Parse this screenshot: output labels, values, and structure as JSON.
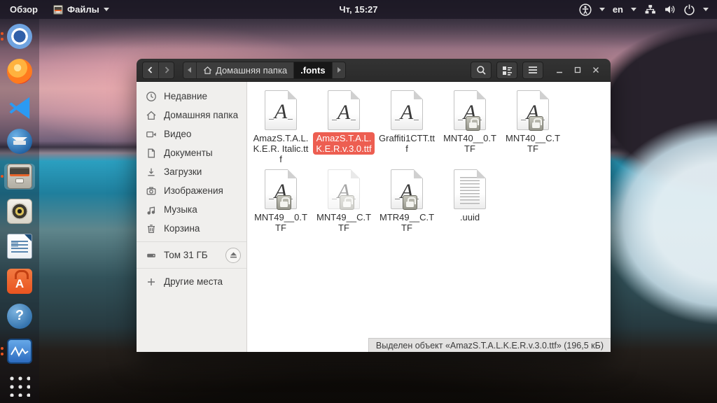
{
  "colors": {
    "selection": "#ed5e51",
    "ubuntu_orange": "#E95420",
    "headerbar_bg": "#2e2e2e",
    "sidebar_bg": "#f0efed"
  },
  "topbar": {
    "activities_label": "Обзор",
    "app_menu_label": "Файлы",
    "clock": "Чт, 15:27",
    "language_indicator": "en",
    "right_icons": [
      "accessibility-icon",
      "language-menu",
      "network-icon",
      "volume-icon",
      "power-icon"
    ]
  },
  "dock": {
    "items": [
      {
        "icon": "chromium-icon",
        "running_dots": 2,
        "active": false
      },
      {
        "icon": "firefox-icon",
        "running_dots": 0,
        "active": false
      },
      {
        "icon": "vscode-icon",
        "running_dots": 0,
        "active": false
      },
      {
        "icon": "thunderbird-icon",
        "running_dots": 0,
        "active": false
      },
      {
        "icon": "files-icon",
        "running_dots": 1,
        "active": true
      },
      {
        "icon": "rhythmbox-icon",
        "running_dots": 0,
        "active": false
      },
      {
        "icon": "libreoffice-writer-icon",
        "running_dots": 0,
        "active": false
      },
      {
        "icon": "ubuntu-software-icon",
        "running_dots": 0,
        "active": false
      },
      {
        "icon": "help-icon",
        "running_dots": 0,
        "active": false
      },
      {
        "icon": "system-monitor-icon",
        "running_dots": 2,
        "active": false
      },
      {
        "icon": "show-applications-icon",
        "running_dots": 0,
        "active": false
      }
    ],
    "help_glyph": "?",
    "software_glyph": "A"
  },
  "window": {
    "pathbar": {
      "home_label": "Домашняя папка",
      "current_segment": ".fonts"
    },
    "sidebar": {
      "items": [
        {
          "icon": "recent-icon",
          "label": "Недавние"
        },
        {
          "icon": "home-icon",
          "label": "Домашняя папка"
        },
        {
          "icon": "video-icon",
          "label": "Видео"
        },
        {
          "icon": "documents-icon",
          "label": "Документы"
        },
        {
          "icon": "downloads-icon",
          "label": "Загрузки"
        },
        {
          "icon": "pictures-icon",
          "label": "Изображения"
        },
        {
          "icon": "music-icon",
          "label": "Музыка"
        },
        {
          "icon": "trash-icon",
          "label": "Корзина"
        }
      ],
      "volume_label": "Том 31 ГБ",
      "other_locations_label": "Другие места"
    },
    "font_glyph": "A",
    "files": [
      {
        "label": "AmazS.T.A.L.K.E.R. Italic.ttf",
        "type": "font",
        "locked": false,
        "selected": false
      },
      {
        "label": "AmazS.T.A.L.K.E.R.v.3.0.ttf",
        "type": "font",
        "locked": false,
        "selected": true
      },
      {
        "label": "Graffiti1CTT.ttf",
        "type": "font",
        "locked": false,
        "selected": false
      },
      {
        "label": "MNT40__0.TTF",
        "type": "font",
        "locked": true,
        "selected": false
      },
      {
        "label": "MNT40__C.TTF",
        "type": "font",
        "locked": true,
        "selected": false
      },
      {
        "label": "MNT49__0.TTF",
        "type": "font",
        "locked": true,
        "selected": false
      },
      {
        "label": "MNT49__C.TTF",
        "type": "font",
        "locked": true,
        "selected": false,
        "faded": true
      },
      {
        "label": "MTR49__C.TTF",
        "type": "font",
        "locked": true,
        "selected": false
      },
      {
        "label": ".uuid",
        "type": "text",
        "locked": false,
        "selected": false
      }
    ],
    "statusbar_text": "Выделен объект «AmazS.T.A.L.K.E.R.v.3.0.ttf» (196,5 кБ)"
  }
}
